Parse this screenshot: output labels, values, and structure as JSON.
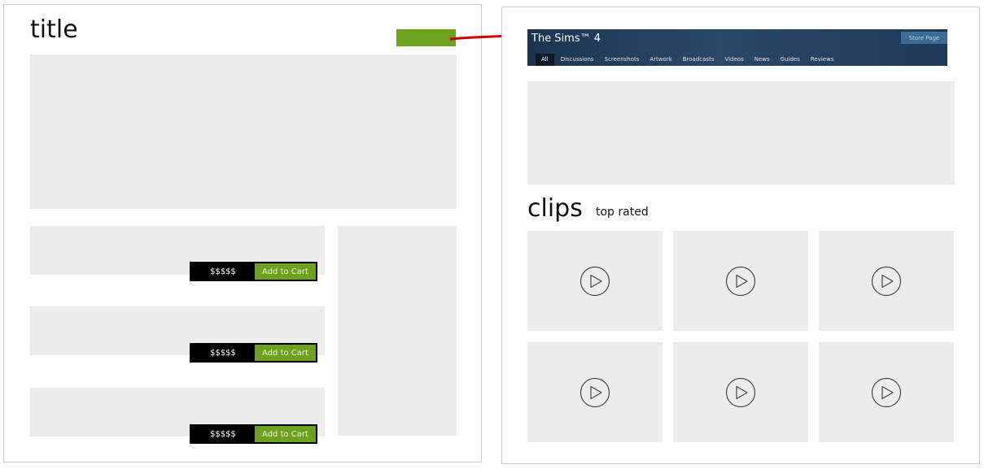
{
  "left_mockup": {
    "title": "title",
    "listings": [
      {
        "price": "$$$$$",
        "cart_label": "Add to Cart"
      },
      {
        "price": "$$$$$",
        "cart_label": "Add to Cart"
      },
      {
        "price": "$$$$$",
        "cart_label": "Add to Cart"
      }
    ]
  },
  "right_mockup": {
    "game_title": "The Sims™ 4",
    "store_button": "Store Page",
    "tabs": [
      "All",
      "Discussions",
      "Screenshots",
      "Artwork",
      "Broadcasts",
      "Videos",
      "News",
      "Guides",
      "Reviews"
    ],
    "active_tab": "All",
    "clips_heading": "clips",
    "clips_subheading": "top rated",
    "clip_count": 6
  },
  "colors": {
    "accent_green": "#6fa120",
    "arrow_red": "#cc0000",
    "placeholder_gray": "#ececec",
    "header_blue": "#1b3550"
  }
}
